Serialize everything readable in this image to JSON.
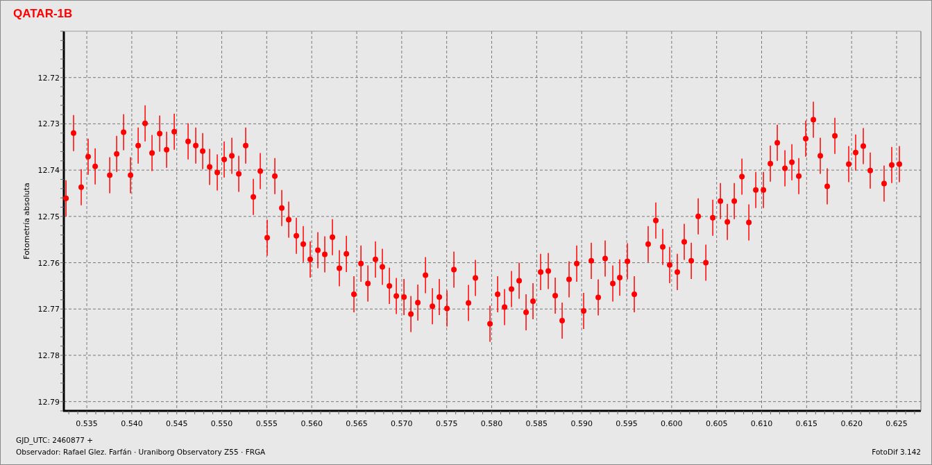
{
  "title": "QATAR-1B",
  "chart_data": {
    "type": "scatter",
    "ylabel": "Fotometría absoluta",
    "xlim": [
      0.53245,
      0.6277
    ],
    "ylim": [
      12.792,
      12.71
    ],
    "xticks": [
      {
        "value": 0.535,
        "label": "0.535"
      },
      {
        "value": 0.54,
        "label": "0.540"
      },
      {
        "value": 0.545,
        "label": "0.545"
      },
      {
        "value": 0.55,
        "label": "0.550"
      },
      {
        "value": 0.555,
        "label": "0.555"
      },
      {
        "value": 0.56,
        "label": "0.560"
      },
      {
        "value": 0.565,
        "label": "0.565"
      },
      {
        "value": 0.57,
        "label": "0.570"
      },
      {
        "value": 0.575,
        "label": "0.575"
      },
      {
        "value": 0.58,
        "label": "0.580"
      },
      {
        "value": 0.585,
        "label": "0.585"
      },
      {
        "value": 0.59,
        "label": "0.590"
      },
      {
        "value": 0.595,
        "label": "0.595"
      },
      {
        "value": 0.6,
        "label": "0.600"
      },
      {
        "value": 0.605,
        "label": "0.605"
      },
      {
        "value": 0.61,
        "label": "0.610"
      },
      {
        "value": 0.615,
        "label": "0.615"
      },
      {
        "value": 0.62,
        "label": "0.620"
      },
      {
        "value": 0.625,
        "label": "0.625"
      }
    ],
    "yticks": [
      {
        "value": 12.72,
        "label": "12.72"
      },
      {
        "value": 12.73,
        "label": "12.73"
      },
      {
        "value": 12.74,
        "label": "12.74"
      },
      {
        "value": 12.75,
        "label": "12.75"
      },
      {
        "value": 12.76,
        "label": "12.76"
      },
      {
        "value": 12.77,
        "label": "12.77"
      },
      {
        "value": 12.78,
        "label": "12.78"
      },
      {
        "value": 12.79,
        "label": "12.79"
      }
    ],
    "x": [
      0.53269,
      0.53353,
      0.53438,
      0.53515,
      0.53593,
      0.53755,
      0.53832,
      0.53909,
      0.53986,
      0.54071,
      0.54148,
      0.54225,
      0.5431,
      0.54387,
      0.54472,
      0.54626,
      0.54711,
      0.54788,
      0.54865,
      0.5495,
      0.55027,
      0.55112,
      0.55189,
      0.55266,
      0.55351,
      0.55428,
      0.55505,
      0.5559,
      0.55667,
      0.55744,
      0.55829,
      0.55906,
      0.55983,
      0.56068,
      0.56145,
      0.5623,
      0.56307,
      0.56385,
      0.56469,
      0.56547,
      0.56624,
      0.56708,
      0.56785,
      0.56863,
      0.5694,
      0.57025,
      0.57102,
      0.57179,
      0.57264,
      0.57341,
      0.57418,
      0.57503,
      0.5758,
      0.57742,
      0.57819,
      0.57981,
      0.58066,
      0.58143,
      0.5822,
      0.58305,
      0.58382,
      0.58459,
      0.58544,
      0.58629,
      0.58706,
      0.58783,
      0.5886,
      0.58945,
      0.59022,
      0.59107,
      0.59184,
      0.59261,
      0.59346,
      0.59423,
      0.59508,
      0.59585,
      0.59739,
      0.59824,
      0.59901,
      0.59978,
      0.60063,
      0.6014,
      0.60218,
      0.60295,
      0.6038,
      0.60457,
      0.60542,
      0.60619,
      0.60696,
      0.60781,
      0.60858,
      0.60935,
      0.6102,
      0.61097,
      0.61174,
      0.61259,
      0.61336,
      0.61413,
      0.6149,
      0.61575,
      0.61652,
      0.61729,
      0.61814,
      0.61968,
      0.62045,
      0.6213,
      0.62207,
      0.62361,
      0.62446,
      0.62531
    ],
    "grid": true,
    "series": [
      {
        "color": "#ff0000",
        "errors": [
          0.0039,
          0.0039,
          0.0039,
          0.0039,
          0.0039,
          0.0039,
          0.0039,
          0.0039,
          0.0039,
          0.0039,
          0.0039,
          0.0039,
          0.0039,
          0.0039,
          0.0039,
          0.0039,
          0.0039,
          0.0039,
          0.0039,
          0.0039,
          0.0039,
          0.0039,
          0.0039,
          0.0039,
          0.0039,
          0.0039,
          0.0039,
          0.0039,
          0.0039,
          0.0039,
          0.0039,
          0.0039,
          0.0039,
          0.0039,
          0.0039,
          0.0039,
          0.0039,
          0.0039,
          0.0039,
          0.0039,
          0.0039,
          0.0039,
          0.0039,
          0.0039,
          0.0039,
          0.0039,
          0.0039,
          0.0039,
          0.0039,
          0.0039,
          0.0039,
          0.0039,
          0.0039,
          0.0039,
          0.0039,
          0.0039,
          0.0039,
          0.0039,
          0.0039,
          0.0039,
          0.0039,
          0.0039,
          0.0039,
          0.0039,
          0.0039,
          0.0039,
          0.0039,
          0.0039,
          0.0039,
          0.0039,
          0.0039,
          0.0039,
          0.0039,
          0.0039,
          0.0039,
          0.0039,
          0.0039,
          0.0039,
          0.0039,
          0.0039,
          0.0039,
          0.0039,
          0.0039,
          0.0039,
          0.0039,
          0.0039,
          0.0039,
          0.0039,
          0.0039,
          0.0039,
          0.0039,
          0.0039,
          0.0039,
          0.0039,
          0.0039,
          0.0039,
          0.0039,
          0.0039,
          0.0039,
          0.0039,
          0.0039,
          0.0039,
          0.0039,
          0.0039,
          0.0039,
          0.0039,
          0.0039,
          0.0039,
          0.0039,
          0.0039
        ],
        "values": [
          12.7461,
          12.732,
          12.7437,
          12.7371,
          12.7392,
          12.7411,
          12.7365,
          12.7318,
          12.7411,
          12.7347,
          12.7299,
          12.7363,
          12.7321,
          12.7356,
          12.7317,
          12.7338,
          12.7347,
          12.7359,
          12.7393,
          12.7405,
          12.7377,
          12.7369,
          12.7408,
          12.7347,
          12.7458,
          12.7402,
          12.7546,
          12.7413,
          12.7482,
          12.7507,
          12.7542,
          12.756,
          12.7593,
          12.7573,
          12.7582,
          12.7545,
          12.7612,
          12.7581,
          12.7668,
          12.7602,
          12.7645,
          12.7593,
          12.7609,
          12.765,
          12.7672,
          12.7674,
          12.7711,
          12.7686,
          12.7627,
          12.7694,
          12.7674,
          12.7699,
          12.7615,
          12.7687,
          12.7633,
          12.7732,
          12.7668,
          12.7696,
          12.7657,
          12.7639,
          12.7707,
          12.7683,
          12.762,
          12.7618,
          12.7671,
          12.7725,
          12.7636,
          12.7602,
          12.7704,
          12.7596,
          12.7675,
          12.7591,
          12.7645,
          12.7632,
          12.7597,
          12.7668,
          12.756,
          12.7509,
          12.7566,
          12.7605,
          12.762,
          12.7555,
          12.7596,
          12.75,
          12.76,
          12.7503,
          12.7467,
          12.7512,
          12.7467,
          12.7414,
          12.7513,
          12.7443,
          12.7443,
          12.7386,
          12.7341,
          12.7396,
          12.7383,
          12.7413,
          12.7332,
          12.7291,
          12.7369,
          12.7435,
          12.7326,
          12.7387,
          12.7362,
          12.7348,
          12.7401,
          12.7429,
          12.7389,
          12.7387
        ]
      }
    ]
  },
  "footer": {
    "date_line": "GJD_UTC: 2460877 +",
    "observer_line": "Observador: Rafael Glez. Farfán · Uraniborg Observatory Z55 · FRGA",
    "software": "FotoDif 3.142"
  }
}
